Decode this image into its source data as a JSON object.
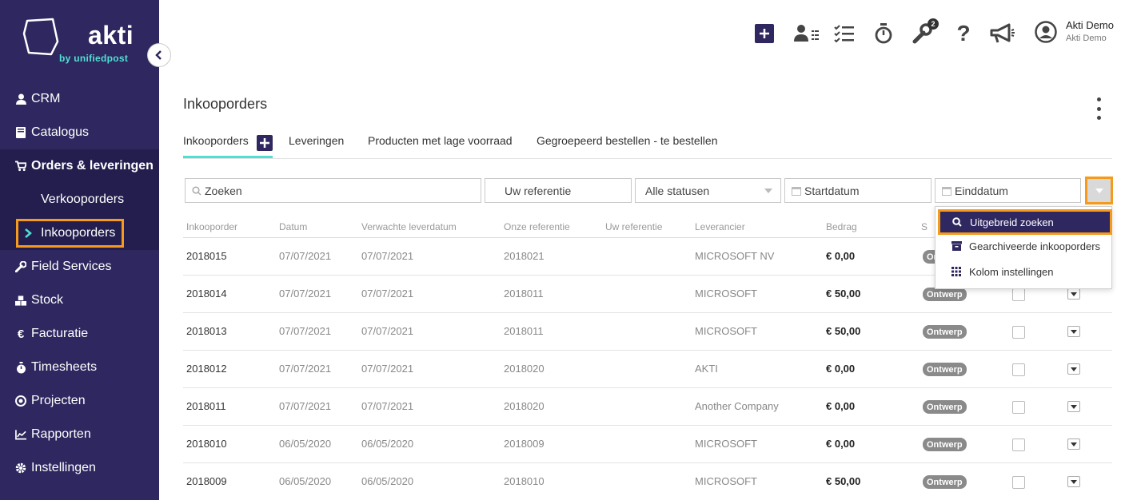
{
  "brand": {
    "name": "akti",
    "tagline": "by unifiedpost",
    "accent": "#2f2860",
    "teal": "#4ee0d2",
    "highlight": "#f59a1c"
  },
  "sidebar": {
    "items": [
      {
        "label": "CRM",
        "icon": "user-icon"
      },
      {
        "label": "Catalogus",
        "icon": "book-icon"
      },
      {
        "label": "Orders & leveringen",
        "icon": "cart-icon"
      },
      {
        "label": "Field Services",
        "icon": "wrench-icon"
      },
      {
        "label": "Stock",
        "icon": "cubes-icon"
      },
      {
        "label": "Facturatie",
        "icon": "euro-icon"
      },
      {
        "label": "Timesheets",
        "icon": "stopwatch-icon"
      },
      {
        "label": "Projecten",
        "icon": "target-icon"
      },
      {
        "label": "Rapporten",
        "icon": "chart-icon"
      },
      {
        "label": "Instellingen",
        "icon": "gear-icon"
      }
    ],
    "subitems": [
      {
        "label": "Verkooporders"
      },
      {
        "label": "Inkooporders"
      }
    ]
  },
  "header": {
    "notifications_count": "2",
    "user_name": "Akti Demo",
    "user_company": "Akti Demo"
  },
  "main": {
    "title": "Inkooporders",
    "tabs": [
      {
        "label": "Inkooporders"
      },
      {
        "label": "Leveringen"
      },
      {
        "label": "Producten met lage voorraad"
      },
      {
        "label": "Gegroepeerd bestellen - te bestellen"
      }
    ],
    "filters": {
      "search_placeholder": "Zoeken",
      "reference_placeholder": "Uw referentie",
      "status_selected": "Alle statusen",
      "start_placeholder": "Startdatum",
      "end_placeholder": "Einddatum"
    },
    "dropdown": {
      "items": [
        {
          "label": "Uitgebreid zoeken"
        },
        {
          "label": "Gearchiveerde inkooporders"
        },
        {
          "label": "Kolom instellingen"
        }
      ]
    },
    "table": {
      "columns": [
        "Inkooporder",
        "Datum",
        "Verwachte leverdatum",
        "Onze referentie",
        "Uw referentie",
        "Leverancier",
        "Bedrag",
        "S"
      ],
      "rows": [
        {
          "id": "2018015",
          "date": "07/07/2021",
          "delivery": "07/07/2021",
          "ref": "2018021",
          "your_ref": "",
          "supplier": "MICROSOFT NV",
          "amount": "€ 0,00",
          "status": "Ontwerp"
        },
        {
          "id": "2018014",
          "date": "07/07/2021",
          "delivery": "07/07/2021",
          "ref": "2018011",
          "your_ref": "",
          "supplier": "MICROSOFT",
          "amount": "€ 50,00",
          "status": "Ontwerp"
        },
        {
          "id": "2018013",
          "date": "07/07/2021",
          "delivery": "07/07/2021",
          "ref": "2018011",
          "your_ref": "",
          "supplier": "MICROSOFT",
          "amount": "€ 50,00",
          "status": "Ontwerp"
        },
        {
          "id": "2018012",
          "date": "07/07/2021",
          "delivery": "07/07/2021",
          "ref": "2018020",
          "your_ref": "",
          "supplier": "AKTI",
          "amount": "€ 0,00",
          "status": "Ontwerp"
        },
        {
          "id": "2018011",
          "date": "07/07/2021",
          "delivery": "07/07/2021",
          "ref": "2018020",
          "your_ref": "",
          "supplier": "Another Company",
          "amount": "€ 0,00",
          "status": "Ontwerp"
        },
        {
          "id": "2018010",
          "date": "06/05/2020",
          "delivery": "06/05/2020",
          "ref": "2018009",
          "your_ref": "",
          "supplier": "MICROSOFT",
          "amount": "€ 0,00",
          "status": "Ontwerp"
        },
        {
          "id": "2018009",
          "date": "06/05/2020",
          "delivery": "06/05/2020",
          "ref": "2018010",
          "your_ref": "",
          "supplier": "MICROSOFT",
          "amount": "€ 50,00",
          "status": "Ontwerp"
        }
      ]
    }
  }
}
